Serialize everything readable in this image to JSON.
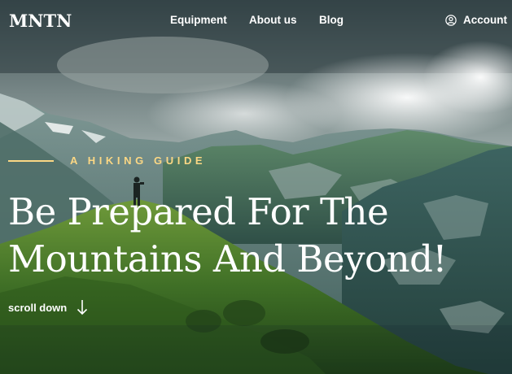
{
  "brand": {
    "logo": "MNTN"
  },
  "nav": {
    "items": [
      {
        "label": "Equipment"
      },
      {
        "label": "About us"
      },
      {
        "label": "Blog"
      }
    ],
    "account": {
      "label": "Account",
      "icon": "user-circle-icon"
    }
  },
  "hero": {
    "tagline": "A HIKING GUIDE",
    "headline_line1": "Be Prepared For The",
    "headline_line2": "Mountains And Beyond!",
    "scroll_label": "scroll down",
    "scroll_icon": "arrow-down-icon"
  },
  "colors": {
    "accent": "#fbd784",
    "text": "#ffffff"
  }
}
